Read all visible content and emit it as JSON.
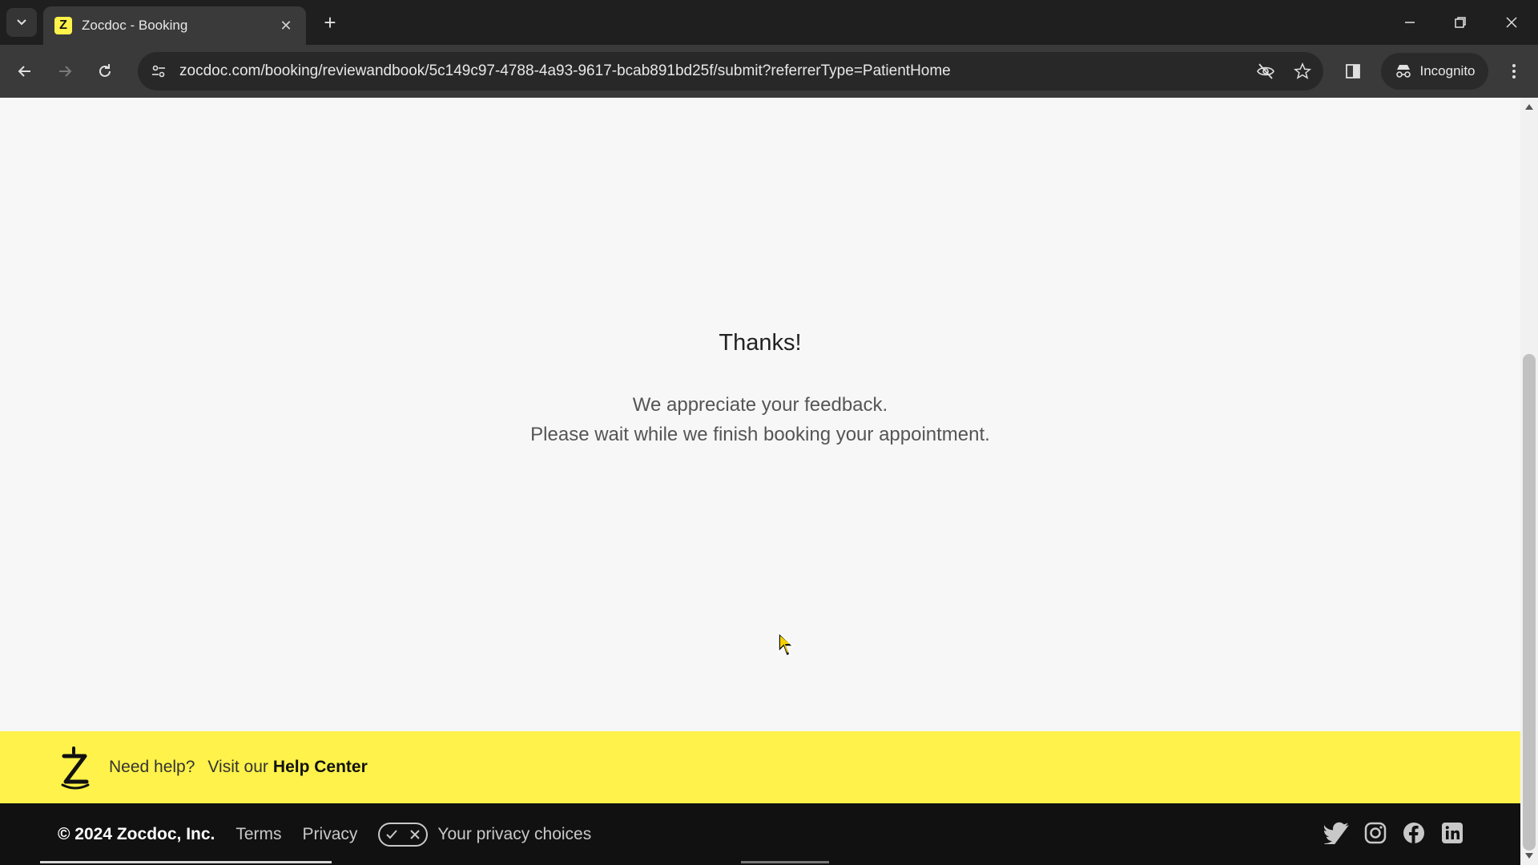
{
  "browser": {
    "tab_title": "Zocdoc - Booking",
    "favicon_letter": "Z",
    "url": "zocdoc.com/booking/reviewandbook/5c149c97-4788-4a93-9617-bcab891bd25f/submit?referrerType=PatientHome",
    "incognito_label": "Incognito"
  },
  "main": {
    "heading": "Thanks!",
    "line1": "We appreciate your feedback.",
    "line2": "Please wait while we finish booking your appointment."
  },
  "helpbar": {
    "need_help": "Need help?",
    "visit": "Visit our",
    "link": "Help Center"
  },
  "footer": {
    "copyright": "© 2024 Zocdoc, Inc.",
    "terms": "Terms",
    "privacy": "Privacy",
    "privacy_choices": "Your privacy choices",
    "socials": [
      "twitter-icon",
      "instagram-icon",
      "facebook-icon",
      "linkedin-icon"
    ]
  },
  "colors": {
    "brand_yellow": "#fff24a",
    "footer_bg": "#111111",
    "chrome_dark": "#1f1f1f",
    "toolbar": "#3a3a3a"
  }
}
